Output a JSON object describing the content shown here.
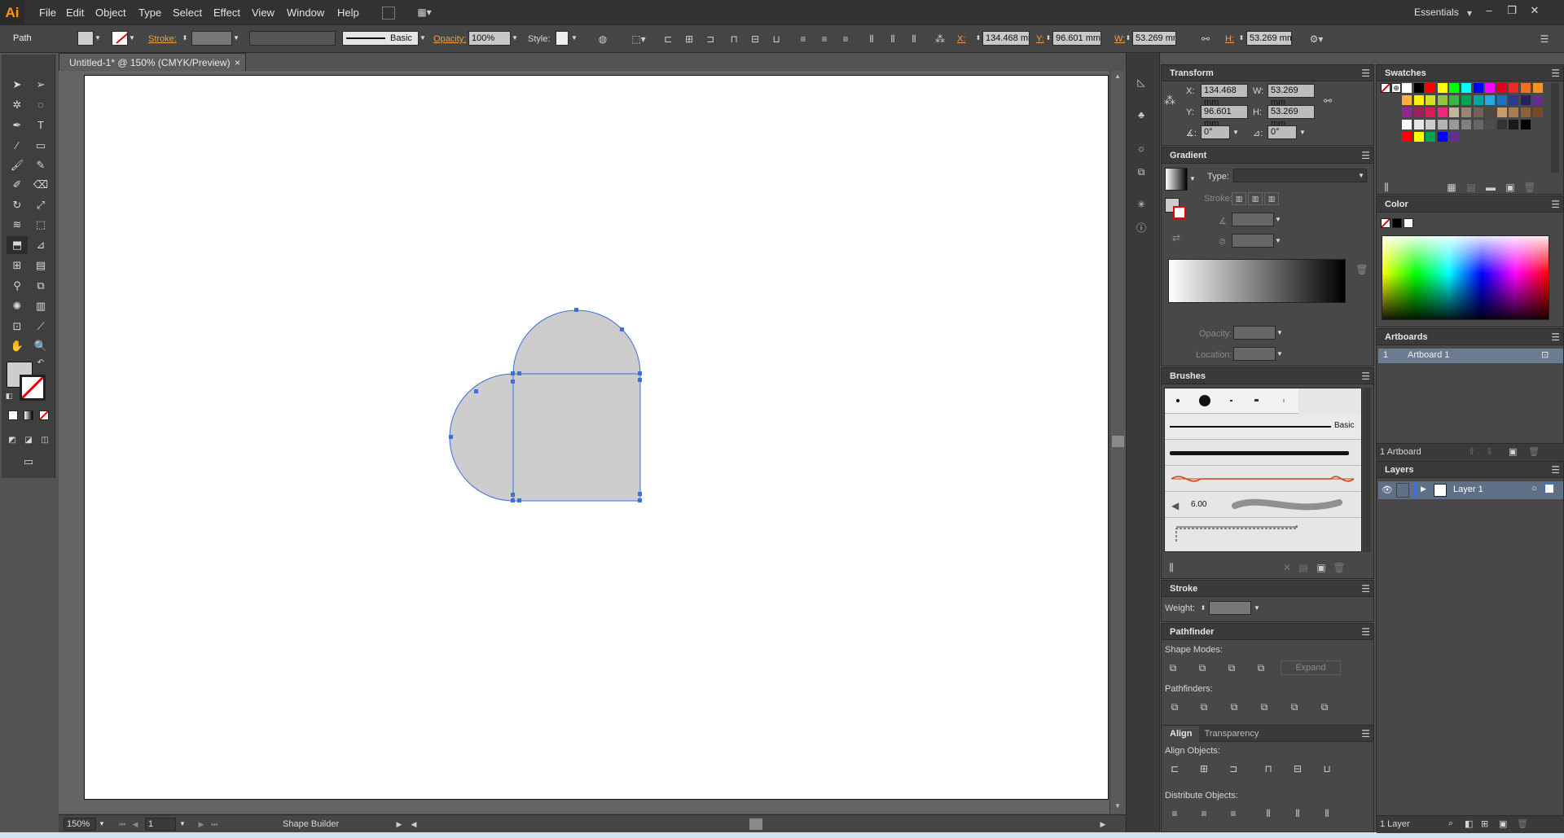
{
  "app": {
    "logo": "Ai",
    "workspace": "Essentials"
  },
  "menu": [
    "File",
    "Edit",
    "Object",
    "Type",
    "Select",
    "Effect",
    "View",
    "Window",
    "Help"
  ],
  "control": {
    "object_type": "Path",
    "stroke_label": "Stroke:",
    "brush": "Basic",
    "opacity_label": "Opacity:",
    "opacity": "100%",
    "style_label": "Style:",
    "x_label": "X:",
    "x": "134.468 mm",
    "y_label": "Y:",
    "y": "96.601 mm",
    "w_label": "W:",
    "w": "53.269 mm",
    "h_label": "H:",
    "h": "53.269 mm"
  },
  "document": {
    "tab": "Untitled-1* @ 150% (CMYK/Preview)",
    "close": "×"
  },
  "status": {
    "zoom": "150%",
    "artboard_nav": "1",
    "tool": "Shape Builder"
  },
  "transform": {
    "title": "Transform",
    "x": "134.468 mm",
    "y": "96.601 mm",
    "w": "53.269 mm",
    "h": "53.269 mm",
    "angle": "0°",
    "shear": "0°",
    "x_label": "X:",
    "y_label": "Y:",
    "w_label": "W:",
    "h_label": "H:"
  },
  "gradient": {
    "title": "Gradient",
    "type_label": "Type:",
    "stroke_label": "Stroke:",
    "opacity_label": "Opacity:",
    "location_label": "Location:"
  },
  "brushes": {
    "title": "Brushes",
    "basic": "Basic",
    "size": "6.00"
  },
  "stroke": {
    "title": "Stroke",
    "weight_label": "Weight:"
  },
  "pathfinder": {
    "title": "Pathfinder",
    "shape_modes": "Shape Modes:",
    "expand": "Expand",
    "pathfinders": "Pathfinders:"
  },
  "align": {
    "title": "Align",
    "tab2": "Transparency",
    "align_objects": "Align Objects:",
    "distribute_objects": "Distribute Objects:"
  },
  "swatches": {
    "title": "Swatches",
    "row1": [
      "#ffffff",
      "#000000",
      "#ff0000",
      "#ffff00",
      "#00ff00",
      "#00ffff",
      "#0000ff",
      "#ff00ff",
      "#e4001b",
      "#ee2a24",
      "#f36f21",
      "#f7941d"
    ],
    "row2": [
      "#fbb040",
      "#fff200",
      "#d7df23",
      "#8dc63f",
      "#39b54a",
      "#00a651",
      "#00a79d",
      "#27aae1",
      "#1c75bc",
      "#2b3990",
      "#262262",
      "#662d91"
    ],
    "row3": [
      "#92278f",
      "#9e1f63",
      "#da1c5c",
      "#ee2a7b",
      "#c2b59b",
      "#998675",
      "#736357",
      "#534741",
      "#c69c6d",
      "#a67c52",
      "#8c6239",
      "#754c24"
    ],
    "row4": [
      "#ffffff",
      "#e6e6e6",
      "#cccccc",
      "#b3b3b3",
      "#999999",
      "#808080",
      "#666666",
      "#4d4d4d",
      "#333333",
      "#1a1a1a",
      "#000000"
    ],
    "row5": [
      "#ff0000",
      "#ffff00",
      "#00a651",
      "#0000ff",
      "#662d91"
    ]
  },
  "color": {
    "title": "Color"
  },
  "artboards": {
    "title": "Artboards",
    "index": "1",
    "name": "Artboard 1",
    "count": "1 Artboard"
  },
  "layers": {
    "title": "Layers",
    "name": "Layer 1",
    "count": "1 Layer"
  }
}
